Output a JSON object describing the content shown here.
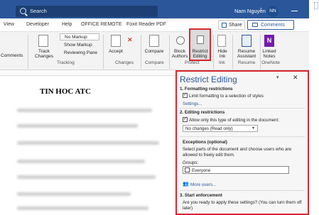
{
  "titlebar": {
    "search_placeholder": "Search",
    "user_name": "Nam Nguyễn",
    "avatar_initials": "NN"
  },
  "tabs": [
    "View",
    "Developer",
    "Help",
    "OFFICE REMOTE",
    "Foxit Reader PDF"
  ],
  "header_buttons": {
    "share": "Share",
    "comments": "Comments"
  },
  "ribbon": {
    "comments_cut": "Comments",
    "tracking": {
      "track_changes": "Track Changes",
      "markup_select": "No Markup",
      "show_markup": "Show Markup",
      "reviewing_pane": "Reviewing Pane",
      "group": "Tracking"
    },
    "changes": {
      "accept": "Accept",
      "group": "Changes"
    },
    "compare": {
      "compare": "Compare",
      "group": "Compare"
    },
    "protect": {
      "block_authors": "Block Authors",
      "restrict_editing": "Restrict Editing",
      "group": "Protect"
    },
    "ink": {
      "hide_ink": "Hide Ink",
      "group": "Ink"
    },
    "resume": {
      "resume_assistant": "Resume Assistant",
      "group": "Resume"
    },
    "onenote": {
      "linked_notes": "Linked Notes",
      "group": "OneNote"
    }
  },
  "document": {
    "title": "TIN HOC ATC"
  },
  "panel": {
    "title": "Restrict Editing",
    "s1_heading": "1. Formatting restrictions",
    "s1_checkbox": "Limit formatting to a selection of styles",
    "s1_settings": "Settings...",
    "s2_heading": "2. Editing restrictions",
    "s2_checkbox": "Allow only this type of editing in the document:",
    "s2_select": "No changes (Read only)",
    "exceptions_heading": "Exceptions (optional)",
    "exceptions_text": "Select parts of the document and choose users who are allowed to freely edit them.",
    "groups_label": "Groups:",
    "groups_item": "Everyone",
    "more_users": "More users...",
    "s3_heading": "3. Start enforcement",
    "s3_text": "Are you ready to apply these settings? (You can turn them off later)"
  },
  "colors": {
    "title_bar": "#2b579a",
    "highlight": "#d9272e",
    "accent": "#2b579a"
  }
}
